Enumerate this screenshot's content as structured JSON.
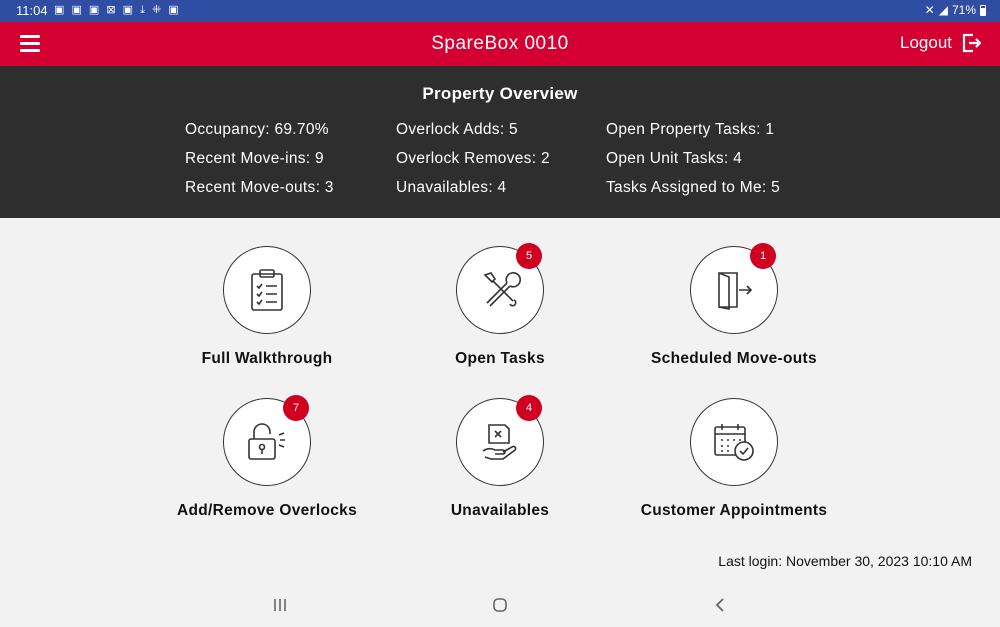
{
  "status_bar": {
    "time": "11:04",
    "notifications": "▣ ▣ ▣ ⊠ ▣ ⤓ ⁜ ▣",
    "battery": "71%"
  },
  "app_bar": {
    "title": "SpareBox 0010",
    "logout_label": "Logout"
  },
  "overview": {
    "title": "Property Overview",
    "col1": [
      "Occupancy: 69.70%",
      "Recent Move-ins: 9",
      "Recent Move-outs: 3"
    ],
    "col2": [
      "Overlock Adds: 5",
      "Overlock Removes: 2",
      "Unavailables: 4"
    ],
    "col3": [
      "Open Property Tasks: 1",
      "Open Unit Tasks: 4",
      "Tasks Assigned to Me: 5"
    ]
  },
  "tiles": [
    {
      "label": "Full Walkthrough",
      "icon": "clipboard-checklist-icon",
      "badge": ""
    },
    {
      "label": "Open Tasks",
      "icon": "wrench-screwdriver-icon",
      "badge": "5"
    },
    {
      "label": "Scheduled Move-outs",
      "icon": "door-exit-icon",
      "badge": "1"
    },
    {
      "label": "Add/Remove Overlocks",
      "icon": "padlock-open-icon",
      "badge": "7"
    },
    {
      "label": "Unavailables",
      "icon": "hand-box-x-icon",
      "badge": "4"
    },
    {
      "label": "Customer Appointments",
      "icon": "calendar-clock-icon",
      "badge": ""
    }
  ],
  "footer": {
    "last_login": "Last login: November 30, 2023 10:10 AM"
  },
  "colors": {
    "brand_red": "#d50032",
    "status_blue": "#2f4ea3",
    "overview_bg": "#2e2e2e",
    "badge_red": "#d00020"
  }
}
